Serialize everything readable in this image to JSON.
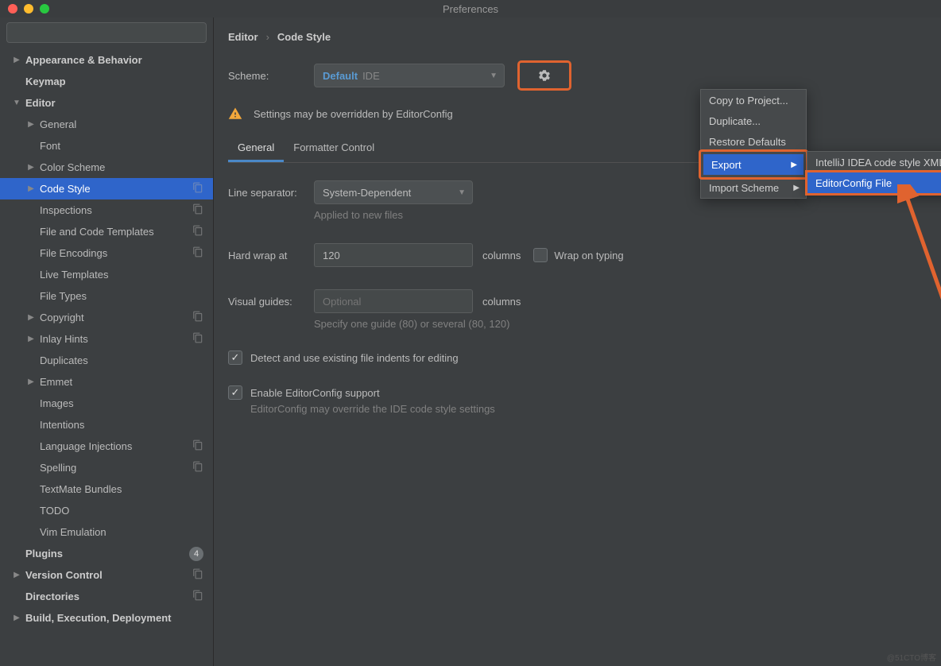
{
  "window": {
    "title": "Preferences"
  },
  "sidebar": {
    "search_placeholder": "",
    "items": [
      {
        "label": "Appearance & Behavior",
        "bold": true,
        "arrow": "right"
      },
      {
        "label": "Keymap",
        "bold": true
      },
      {
        "label": "Editor",
        "bold": true,
        "arrow": "down"
      },
      {
        "label": "General",
        "depth": 1,
        "arrow": "right"
      },
      {
        "label": "Font",
        "depth": 1
      },
      {
        "label": "Color Scheme",
        "depth": 1,
        "arrow": "right"
      },
      {
        "label": "Code Style",
        "depth": 1,
        "arrow": "right",
        "selected": true,
        "copy": true
      },
      {
        "label": "Inspections",
        "depth": 1,
        "copy": true
      },
      {
        "label": "File and Code Templates",
        "depth": 1,
        "copy": true
      },
      {
        "label": "File Encodings",
        "depth": 1,
        "copy": true
      },
      {
        "label": "Live Templates",
        "depth": 1
      },
      {
        "label": "File Types",
        "depth": 1
      },
      {
        "label": "Copyright",
        "depth": 1,
        "arrow": "right",
        "copy": true
      },
      {
        "label": "Inlay Hints",
        "depth": 1,
        "arrow": "right",
        "copy": true
      },
      {
        "label": "Duplicates",
        "depth": 1
      },
      {
        "label": "Emmet",
        "depth": 1,
        "arrow": "right"
      },
      {
        "label": "Images",
        "depth": 1
      },
      {
        "label": "Intentions",
        "depth": 1
      },
      {
        "label": "Language Injections",
        "depth": 1,
        "copy": true
      },
      {
        "label": "Spelling",
        "depth": 1,
        "copy": true
      },
      {
        "label": "TextMate Bundles",
        "depth": 1
      },
      {
        "label": "TODO",
        "depth": 1
      },
      {
        "label": "Vim Emulation",
        "depth": 1
      },
      {
        "label": "Plugins",
        "bold": true,
        "badge": "4"
      },
      {
        "label": "Version Control",
        "bold": true,
        "arrow": "right",
        "copy": true
      },
      {
        "label": "Directories",
        "bold": true,
        "copy": true
      },
      {
        "label": "Build, Execution, Deployment",
        "bold": true,
        "arrow": "right"
      }
    ]
  },
  "breadcrumb": {
    "root": "Editor",
    "leaf": "Code Style"
  },
  "scheme": {
    "label": "Scheme:",
    "primary": "Default",
    "secondary": "IDE"
  },
  "warning": "Settings may be overridden by EditorConfig",
  "tabs": [
    "General",
    "Formatter Control"
  ],
  "line_sep": {
    "label": "Line separator:",
    "value": "System-Dependent",
    "hint": "Applied to new files"
  },
  "hard_wrap": {
    "label": "Hard wrap at",
    "value": "120",
    "columns": "columns",
    "wrap_label": "Wrap on typing"
  },
  "visual_guides": {
    "label": "Visual guides:",
    "placeholder": "Optional",
    "columns": "columns",
    "hint": "Specify one guide (80) or several (80, 120)"
  },
  "detect_indents": "Detect and use existing file indents for editing",
  "enable_ec": {
    "label": "Enable EditorConfig support",
    "hint": "EditorConfig may override the IDE code style settings"
  },
  "gear_menu": {
    "items": [
      "Copy to Project...",
      "Duplicate...",
      "Restore Defaults",
      "Export",
      "Import Scheme"
    ]
  },
  "export_submenu": {
    "items": [
      "IntelliJ IDEA code style XML",
      "EditorConfig File"
    ]
  },
  "watermark": "@51CTO博客"
}
